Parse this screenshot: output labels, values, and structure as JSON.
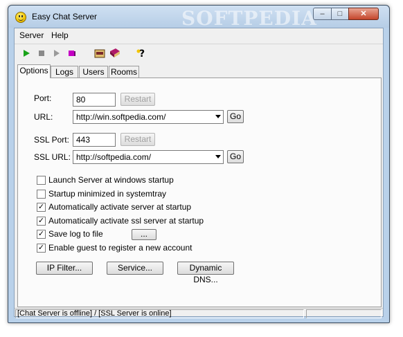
{
  "window": {
    "title": "Easy Chat Server",
    "watermark": "SOFTPEDIA",
    "controls": {
      "minimize": "–",
      "maximize": "□",
      "close": "✕"
    }
  },
  "menu": {
    "items": [
      {
        "label": "Server"
      },
      {
        "label": "Help"
      }
    ]
  },
  "toolbar": {
    "icons": [
      "play-icon",
      "stop-icon",
      "pause-icon",
      "eraser-icon",
      "chat-icon",
      "book-icon",
      "help-icon"
    ],
    "colors": {
      "play": "#1aa31a",
      "eraser": "#c400c4"
    }
  },
  "tabs": [
    {
      "label": "Options"
    },
    {
      "label": "Logs"
    },
    {
      "label": "Users"
    },
    {
      "label": "Rooms"
    }
  ],
  "options": {
    "port_label": "Port:",
    "port_value": "80",
    "restart_label": "Restart",
    "url_label": "URL:",
    "url_value": "http://win.softpedia.com/",
    "go_label": "Go",
    "ssl_port_label": "SSL Port:",
    "ssl_port_value": "443",
    "ssl_restart_label": "Restart",
    "ssl_url_label": "SSL URL:",
    "ssl_url_value": "http://softpedia.com/",
    "ssl_go_label": "Go",
    "checkboxes": [
      {
        "label": "Launch Server at windows startup",
        "checked": false
      },
      {
        "label": "Startup minimized in systemtray",
        "checked": false
      },
      {
        "label": "Automatically activate server at startup",
        "checked": true
      },
      {
        "label": "Automatically activate ssl server at startup",
        "checked": true
      },
      {
        "label": "Save log to file",
        "checked": true
      },
      {
        "label": "Enable guest to register a new account",
        "checked": true
      }
    ],
    "browse_label": "...",
    "ip_filter_label": "IP Filter...",
    "service_label": "Service...",
    "dynamic_dns_label": "Dynamic DNS..."
  },
  "status": {
    "text": "[Chat Server is offline] / [SSL Server is online]"
  }
}
